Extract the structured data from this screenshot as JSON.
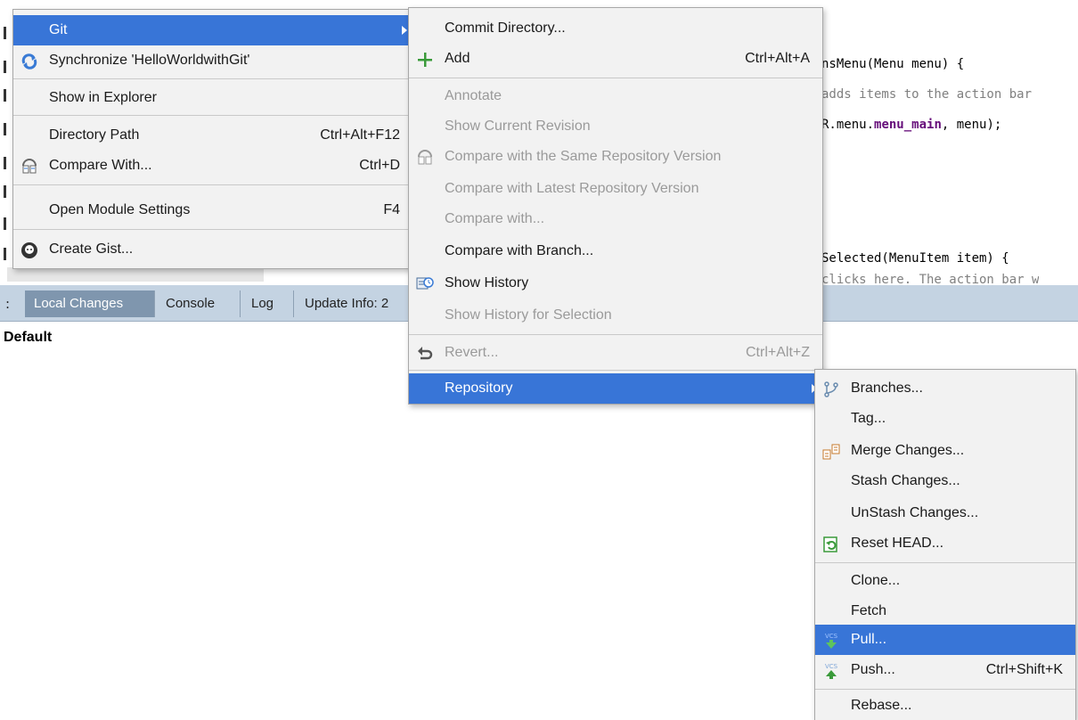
{
  "editor": {
    "line1_text": "nsMenu(Menu menu) {",
    "line2_text": "adds items to the action bar",
    "line3_pre": "R.menu.",
    "line3_kw": "menu_main",
    "line3_post": ", menu);",
    "line4_text": "Selected(MenuItem item) {",
    "line5_text": "clicks here. The action bar w"
  },
  "toolwindow": {
    "tabs": [
      "Local Changes",
      "Console",
      "Log",
      "Update Info: 2"
    ],
    "left_stub": ":",
    "default_label": "Default"
  },
  "context_menu": {
    "items": [
      {
        "label": "Git",
        "mnemonic": "G",
        "submenu": true,
        "selected": true
      },
      {
        "label": "Synchronize 'HelloWorldwithGit'",
        "icon": "sync-icon"
      },
      {
        "label": "Show in Explorer"
      },
      {
        "label": "Directory Path",
        "shortcut": "Ctrl+Alt+F12"
      },
      {
        "label": "Compare With...",
        "shortcut": "Ctrl+D",
        "icon": "compare-icon"
      },
      {
        "label": "Open Module Settings",
        "shortcut": "F4"
      },
      {
        "label": "Create Gist...",
        "icon": "github-icon"
      }
    ]
  },
  "git_menu": {
    "commit": "Commit Directory...",
    "add": "Add",
    "add_shortcut": "Ctrl+Alt+A",
    "annotate": "Annotate",
    "show_current_revision": "Show Current Revision",
    "compare_same_repo": "Compare with the Same Repository Version",
    "compare_latest_repo": "Compare with Latest Repository Version",
    "compare_with": "Compare with...",
    "compare_branch": "Compare with Branch...",
    "show_history": "Show History",
    "show_history_selection": "Show History for Selection",
    "revert": "Revert...",
    "revert_shortcut": "Ctrl+Alt+Z",
    "repository": "Repository"
  },
  "repository_menu": {
    "branches": "Branches...",
    "tag": "Tag...",
    "merge": "Merge Changes...",
    "stash": "Stash Changes...",
    "unstash": "UnStash Changes...",
    "reset_head": "Reset HEAD...",
    "clone": "Clone...",
    "fetch": "Fetch",
    "pull": "Pull...",
    "push": "Push...",
    "push_shortcut": "Ctrl+Shift+K",
    "rebase": "Rebase...",
    "vcs_icon_text": "VCS"
  },
  "colors": {
    "selection": "#3875d7",
    "menu_bg": "#f2f2f2",
    "disabled_text": "#9a9a9a",
    "add_green": "#3a9a3a"
  }
}
